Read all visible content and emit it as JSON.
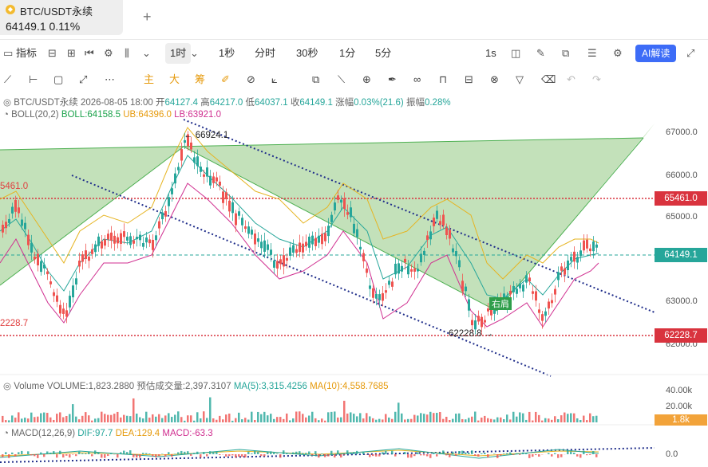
{
  "tab": {
    "title": "BTC/USDT永续",
    "price": "64149.1",
    "change": "0.11%",
    "add": "+"
  },
  "toolbar": {
    "indicators": "指标",
    "timeframes": [
      "1时",
      "1秒",
      "分时",
      "30秒",
      "1分",
      "5分"
    ],
    "active_timeframe": "1时",
    "interval": "1s",
    "ai": "AI解读"
  },
  "draw_tools": {
    "main": "主",
    "big": "大",
    "chip": "筹"
  },
  "ohlc": {
    "symbol": "BTC/USDT永续",
    "datetime": "2026-08-05 18:00",
    "open_label": "开",
    "open": "64127.4",
    "high_label": "高",
    "high": "64217.0",
    "low_label": "低",
    "low": "64037.1",
    "close_label": "收",
    "close": "64149.1",
    "change_label": "涨幅",
    "change": "0.03%(21.6)",
    "amp_label": "振幅",
    "amp": "0.28%"
  },
  "boll": {
    "name": "BOLL(20,2)",
    "mid": "BOLL:64158.5",
    "ub": "UB:64396.0",
    "lb": "LB:63921.0"
  },
  "price_axis": [
    "67000.0",
    "66000.0",
    "65000.0",
    "64000.0",
    "63000.0",
    "62000.0"
  ],
  "tags": {
    "upper_level": "65461.0",
    "current": "64149.1",
    "lower_level": "62228.7"
  },
  "annotations": {
    "high_marker": "← 66924.1",
    "low_marker": "62228.8 →",
    "left_upper": "5461.0",
    "left_lower": "2228.7",
    "pattern_label": "右肩"
  },
  "volume": {
    "name": "Volume",
    "volume": "VOLUME:1,823.2880",
    "est": "预估成交量:2,397.3107",
    "ma5": "MA(5):3,315.4256",
    "ma10": "MA(10):4,558.7685",
    "axis": [
      "40.00k",
      "20.00k"
    ],
    "tag": "1.8k"
  },
  "macd": {
    "name": "MACD(12,26,9)",
    "dif": "DIF:97.7",
    "dea": "DEA:129.4",
    "macd": "MACD:-63.3",
    "axis": "0.0"
  },
  "colors": {
    "up": "#26a69a",
    "down": "#ef5350",
    "accent": "#3d6cf7",
    "level": "#d9333e",
    "triangle": "#b8dcae"
  }
}
